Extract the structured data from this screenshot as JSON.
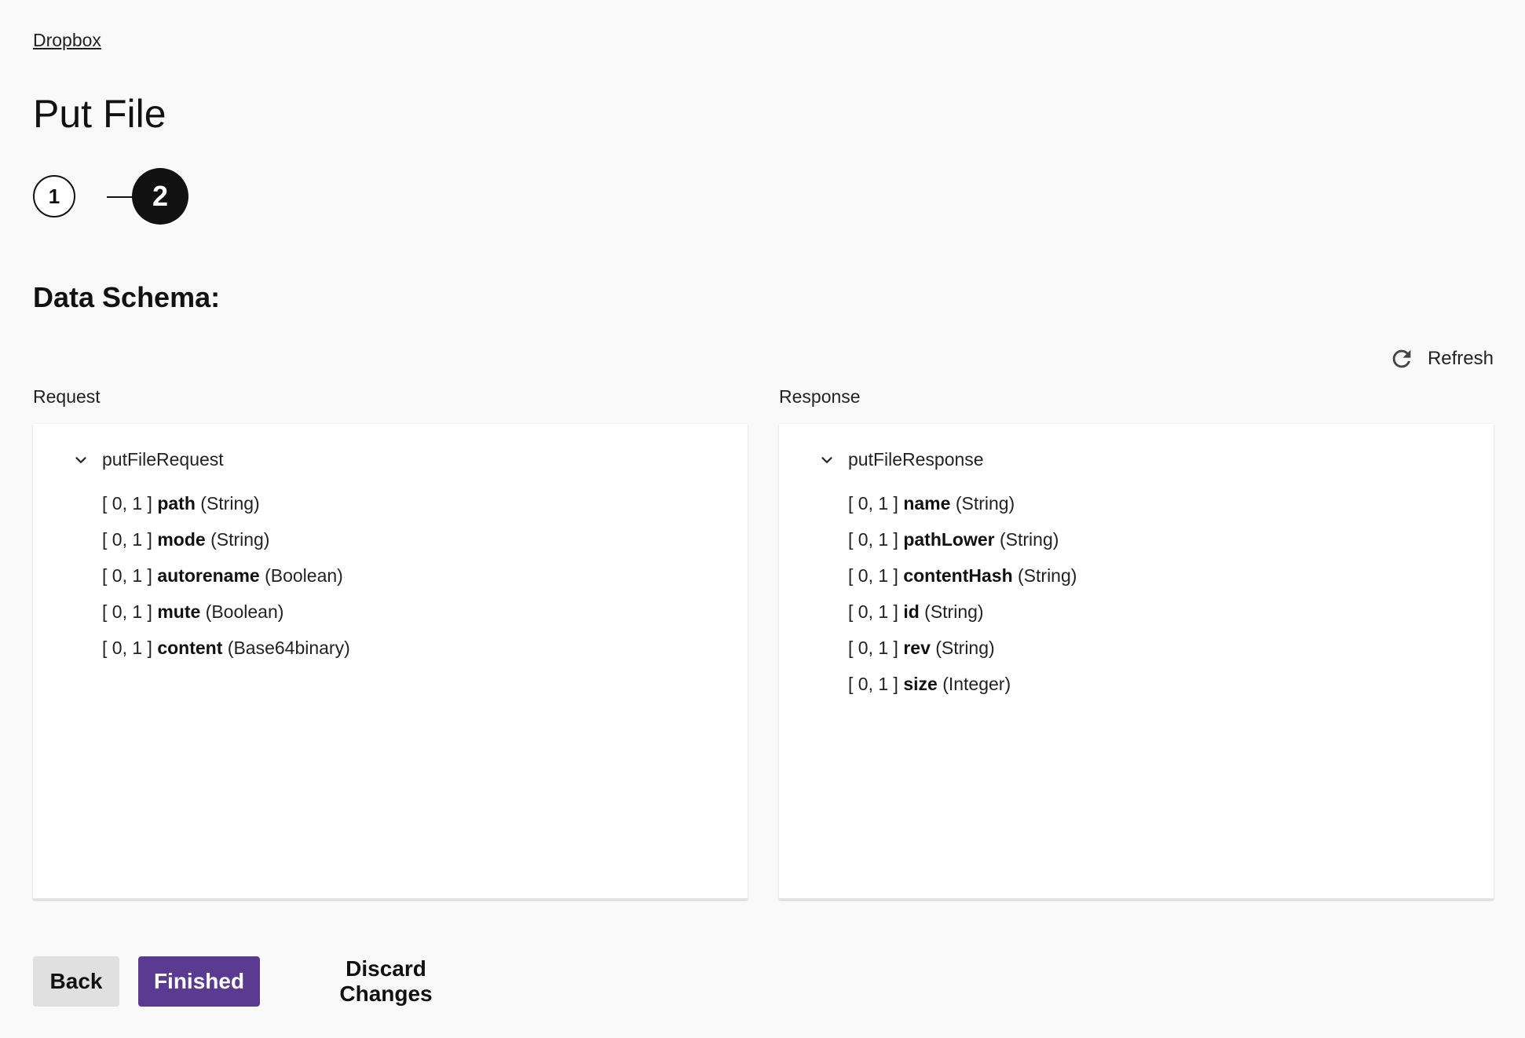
{
  "breadcrumb": {
    "label": "Dropbox"
  },
  "page": {
    "title": "Put File"
  },
  "stepper": {
    "steps": [
      {
        "number": "1",
        "state": "completed"
      },
      {
        "number": "2",
        "state": "active"
      }
    ]
  },
  "section": {
    "title": "Data Schema:"
  },
  "refresh": {
    "label": "Refresh",
    "icon": "refresh-icon"
  },
  "request": {
    "label": "Request",
    "root": "putFileRequest",
    "fields": [
      {
        "card": "[ 0, 1 ]",
        "name": "path",
        "type": "(String)"
      },
      {
        "card": "[ 0, 1 ]",
        "name": "mode",
        "type": "(String)"
      },
      {
        "card": "[ 0, 1 ]",
        "name": "autorename",
        "type": "(Boolean)"
      },
      {
        "card": "[ 0, 1 ]",
        "name": "mute",
        "type": "(Boolean)"
      },
      {
        "card": "[ 0, 1 ]",
        "name": "content",
        "type": "(Base64binary)"
      }
    ]
  },
  "response": {
    "label": "Response",
    "root": "putFileResponse",
    "fields": [
      {
        "card": "[ 0, 1 ]",
        "name": "name",
        "type": "(String)"
      },
      {
        "card": "[ 0, 1 ]",
        "name": "pathLower",
        "type": "(String)"
      },
      {
        "card": "[ 0, 1 ]",
        "name": "contentHash",
        "type": "(String)"
      },
      {
        "card": "[ 0, 1 ]",
        "name": "id",
        "type": "(String)"
      },
      {
        "card": "[ 0, 1 ]",
        "name": "rev",
        "type": "(String)"
      },
      {
        "card": "[ 0, 1 ]",
        "name": "size",
        "type": "(Integer)"
      }
    ]
  },
  "footer": {
    "back_label": "Back",
    "finished_label": "Finished",
    "discard_label": "Discard Changes"
  },
  "colors": {
    "primary": "#5a3b91",
    "secondary_button": "#e0e0e0",
    "background": "#f9f9f9",
    "step_active": "#111111"
  }
}
